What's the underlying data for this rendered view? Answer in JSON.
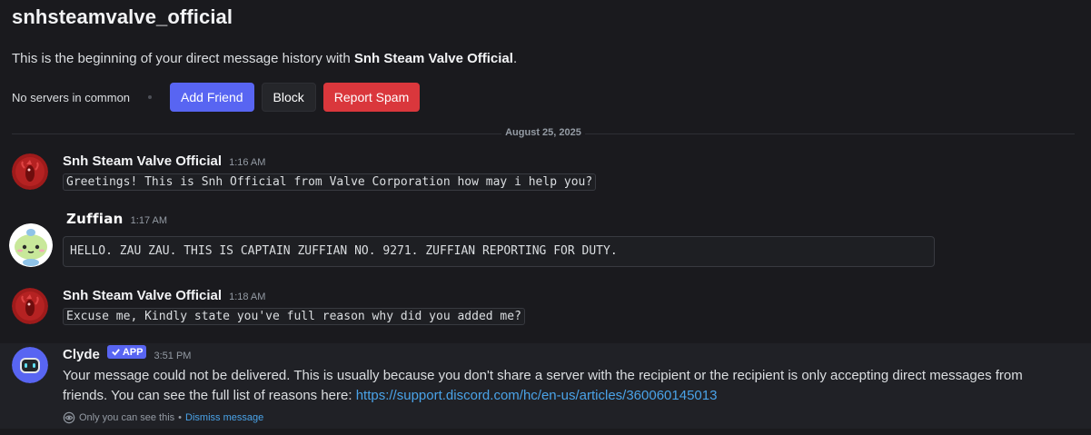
{
  "header": {
    "title": "snhsteamvalve_official"
  },
  "intro": {
    "prefix": "This is the beginning of your direct message history with ",
    "name": "Snh Steam Valve Official",
    "suffix": "."
  },
  "actions": {
    "no_servers": "No servers in common",
    "add_friend": "Add Friend",
    "block": "Block",
    "report_spam": "Report Spam"
  },
  "divider": {
    "date": "August 25, 2025"
  },
  "messages": [
    {
      "author": "Snh Steam Valve Official",
      "time": "1:16 AM",
      "content": "Greetings! This is Snh Official from Valve Corporation how may i help you?"
    },
    {
      "author": "Zuffian",
      "time": "1:17 AM",
      "content": "HELLO. ZAU ZAU. THIS IS CAPTAIN ZUFFIAN NO. 9271. ZUFFIAN REPORTING FOR DUTY."
    },
    {
      "author": "Snh Steam Valve Official",
      "time": "1:18 AM",
      "content": "Excuse me, Kindly state you've full reason why did you added me?"
    }
  ],
  "clyde": {
    "author": "Clyde",
    "badge": "APP",
    "time": "3:51 PM",
    "text": "Your message could not be delivered. This is usually because you don't share a server with the recipient or the recipient is only accepting direct messages from friends. You can see the full list of reasons here: ",
    "link": "https://support.discord.com/hc/en-us/articles/360060145013",
    "only_you": "Only you can see this",
    "separator": " • ",
    "dismiss": "Dismiss message"
  },
  "colors": {
    "background": "#1a1a1e",
    "blurple": "#5865f2",
    "danger": "#da373c",
    "link": "#4aa3e8"
  },
  "icons": {
    "valve_avatar": "red-crustacean-avatar",
    "zuffian_avatar": "green-alien-avatar",
    "clyde_avatar": "clyde-bot-avatar",
    "checkmark": "verified-check-icon",
    "eye": "eye-icon"
  }
}
